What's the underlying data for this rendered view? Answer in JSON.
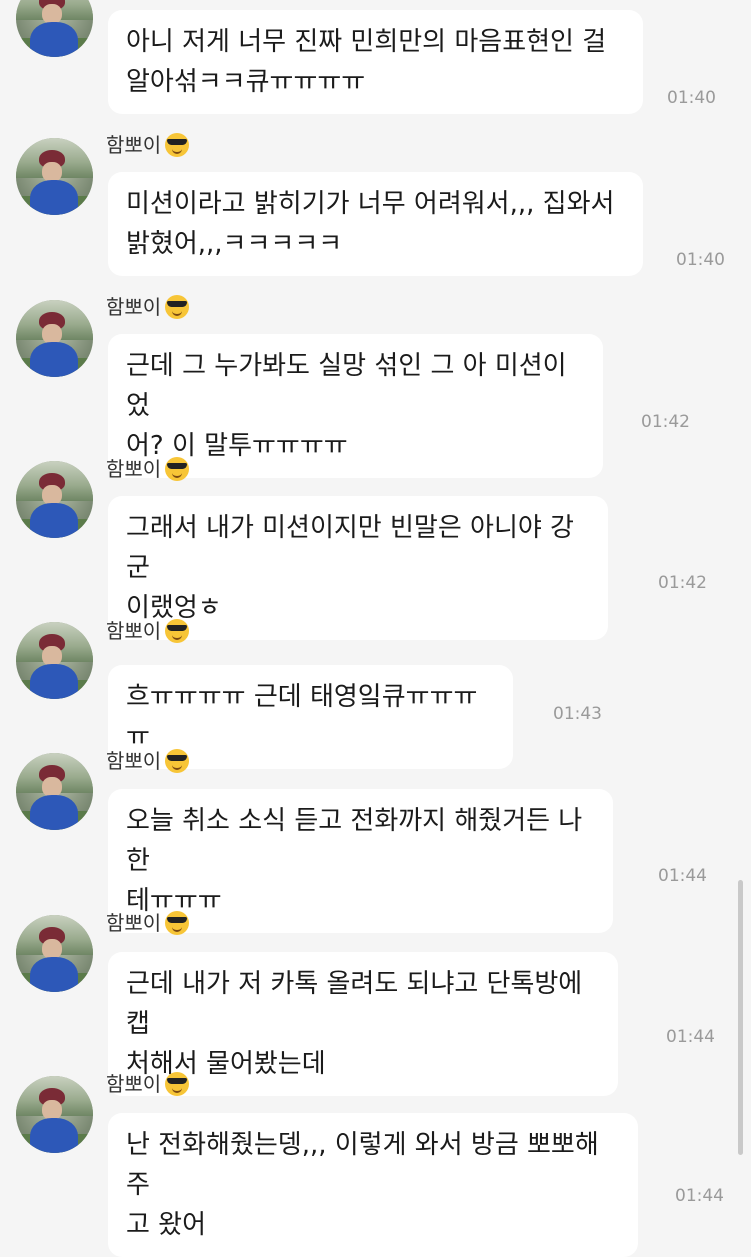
{
  "chat": {
    "messages": [
      {
        "show_header": false,
        "sender": "",
        "text": "아니 저게 너무 진짜 민희만의 마음표현인 걸\n알아섞ㅋㅋ큐ㅠㅠㅠㅠ",
        "time": "01:40"
      },
      {
        "show_header": true,
        "sender": "함뽀이",
        "text": "미션이라고 밝히기가 너무 어려워서,,, 집와서\n밝혔어,,,ㅋㅋㅋㅋㅋ",
        "time": "01:40"
      },
      {
        "show_header": true,
        "sender": "함뽀이",
        "text": "근데 그 누가봐도 실망 섞인 그 아 미션이었\n어? 이 말투ㅠㅠㅠㅠ",
        "time": "01:42"
      },
      {
        "show_header": true,
        "sender": "함뽀이",
        "text": "그래서 내가 미션이지만 빈말은 아니야 강군\n이랬엉ㅎ",
        "time": "01:42"
      },
      {
        "show_header": true,
        "sender": "함뽀이",
        "text": "흐ㅠㅠㅠㅠ 근데 태영잌큐ㅠㅠㅠㅠ",
        "time": "01:43"
      },
      {
        "show_header": true,
        "sender": "함뽀이",
        "text": "오늘 취소 소식 듣고 전화까지 해줬거든 나한\n테ㅠㅠㅠ",
        "time": "01:44"
      },
      {
        "show_header": true,
        "sender": "함뽀이",
        "text": "근데 내가 저 카톡 올려도 되냐고 단톡방에 캡\n처해서 물어봤는데",
        "time": "01:44"
      },
      {
        "show_header": true,
        "sender": "함뽀이",
        "text": "난 전화해줬는뎅,,, 이렇게 와서 방금 뽀뽀해주\n고 왔어",
        "time": "01:44"
      }
    ]
  },
  "colors": {
    "background": "#f5f5f5",
    "bubble": "#ffffff",
    "text": "#1b1b1b",
    "timestamp": "#9a9a9a"
  },
  "icons": {
    "sender_emoji": "smiling-face-with-sunglasses-icon"
  }
}
